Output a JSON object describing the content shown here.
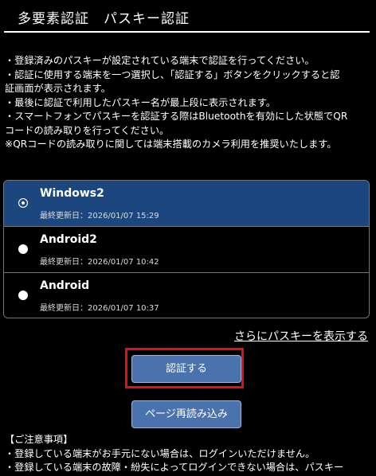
{
  "header": {
    "title": "多要素認証　パスキー認証"
  },
  "instructions": [
    "・登録済みのパスキーが設定されている端末で認証を行ってください。",
    "・認証に使用する端末を一つ選択し、「認証する」ボタンをクリックすると認",
    "証画面が表示されます。",
    "・最後に認証で利用したパスキー名が最上段に表示されます。",
    "・スマートフォンでパスキーを認証する際はBluetoothを有効にした状態でQR",
    "コードの読み取りを行ってください。",
    "※QRコードの読み取りに関しては端末搭載のカメラ利用を推奨いたします。"
  ],
  "passkeys": [
    {
      "name": "Windows2",
      "updated": "最終更新日：2026/01/07 15:29",
      "selected": true
    },
    {
      "name": "Android2",
      "updated": "最終更新日：2026/01/07 10:42",
      "selected": false
    },
    {
      "name": "Android",
      "updated": "最終更新日：2026/01/07 10:37",
      "selected": false
    }
  ],
  "more_link": "さらにパスキーを表示する",
  "buttons": {
    "authenticate": "認証する",
    "reload": "ページ再読み込み"
  },
  "notes": [
    "【ご注意事項】",
    "・登録している端末がお手元にない場合は、ログインいただけません。",
    "・登録している端末の故障・紛失によってログインできない場合は、パスキー"
  ],
  "colors": {
    "selected_row": "#1b477e",
    "button": "#4a72ad",
    "highlight": "#e0101a"
  }
}
